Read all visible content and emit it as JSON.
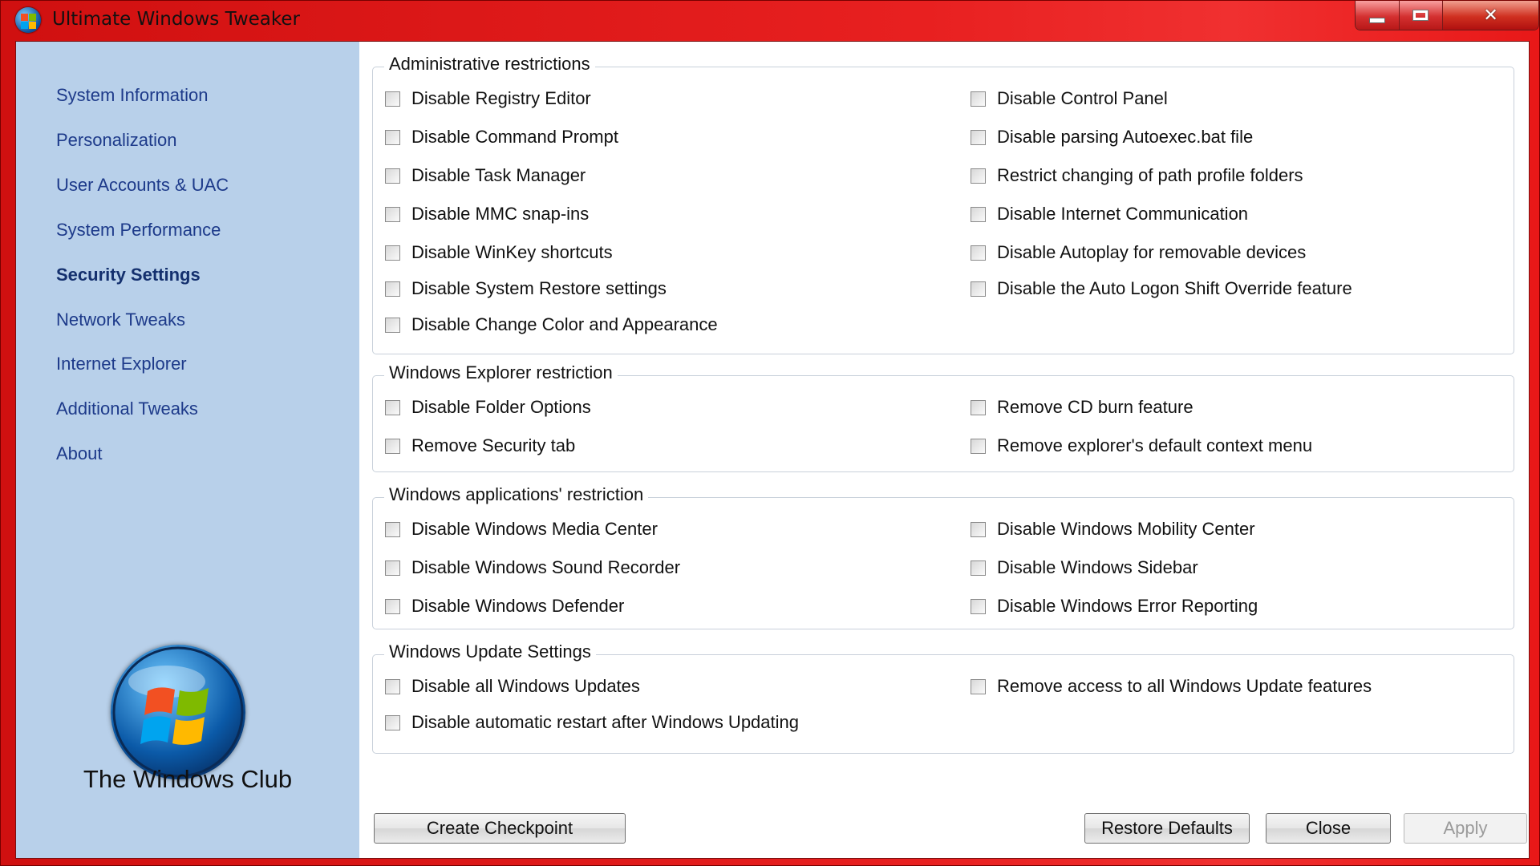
{
  "window": {
    "title": "Ultimate Windows Tweaker"
  },
  "sidebar": {
    "items": [
      {
        "label": "System Information",
        "active": false
      },
      {
        "label": "Personalization",
        "active": false
      },
      {
        "label": "User Accounts & UAC",
        "active": false
      },
      {
        "label": "System Performance",
        "active": false
      },
      {
        "label": "Security Settings",
        "active": true
      },
      {
        "label": "Network Tweaks",
        "active": false
      },
      {
        "label": "Internet Explorer",
        "active": false
      },
      {
        "label": "Additional Tweaks",
        "active": false
      },
      {
        "label": "About",
        "active": false
      }
    ],
    "brand": "The Windows Club"
  },
  "groups": {
    "admin": {
      "title": "Administrative restrictions",
      "left": [
        "Disable Registry Editor",
        "Disable Command Prompt",
        "Disable Task Manager",
        "Disable MMC snap-ins",
        "Disable WinKey shortcuts",
        "Disable System Restore settings",
        "Disable Change Color and Appearance"
      ],
      "right": [
        "Disable Control Panel",
        "Disable parsing Autoexec.bat file",
        "Restrict changing of path profile folders",
        "Disable Internet Communication",
        "Disable Autoplay for removable devices",
        "Disable the Auto Logon Shift Override feature"
      ]
    },
    "explorer": {
      "title": "Windows Explorer restriction",
      "left": [
        "Disable Folder Options",
        "Remove Security tab"
      ],
      "right": [
        "Remove CD burn feature",
        "Remove explorer's default context menu"
      ]
    },
    "apps": {
      "title": "Windows applications' restriction",
      "left": [
        "Disable Windows Media Center",
        "Disable Windows Sound Recorder",
        "Disable Windows Defender"
      ],
      "right": [
        "Disable Windows Mobility Center",
        "Disable Windows Sidebar",
        "Disable Windows Error Reporting"
      ]
    },
    "update": {
      "title": "Windows Update Settings",
      "left": [
        "Disable all Windows Updates",
        "Disable automatic restart after Windows Updating"
      ],
      "right": [
        "Remove access to all Windows Update features"
      ]
    }
  },
  "buttons": {
    "create_checkpoint": "Create Checkpoint",
    "restore_defaults": "Restore Defaults",
    "close": "Close",
    "apply": "Apply"
  },
  "colors": {
    "titlebar": "#e02020",
    "sidebar": "#b8d0ea",
    "nav_text": "#1d3a8a"
  }
}
